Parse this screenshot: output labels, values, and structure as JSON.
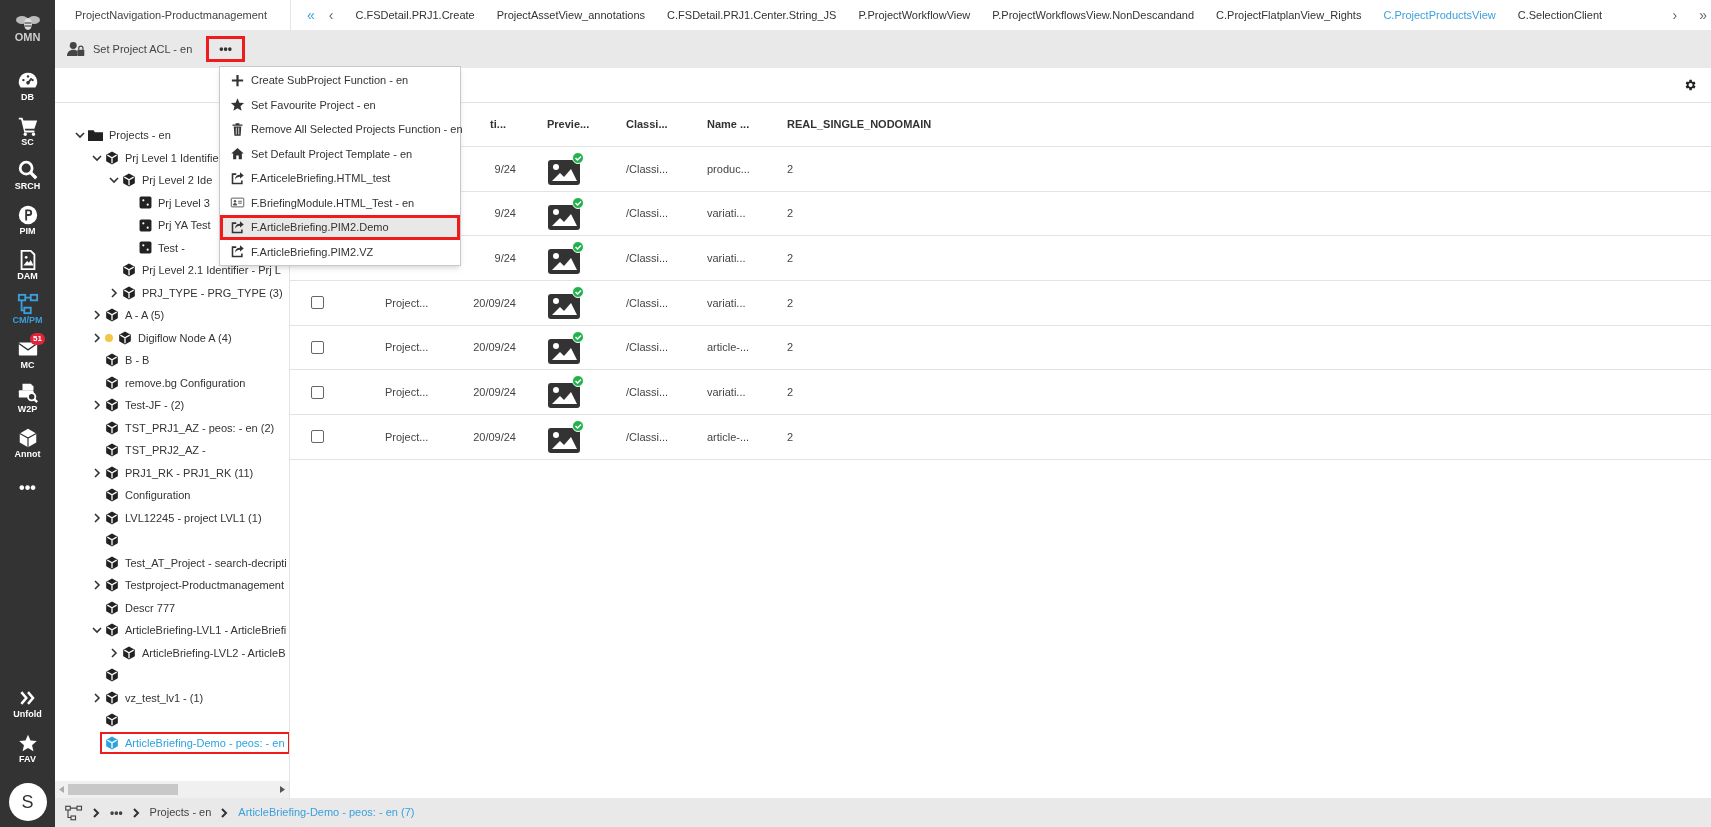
{
  "sidebar": {
    "logo": "OMN",
    "items": [
      {
        "label": "DB",
        "selected": false
      },
      {
        "label": "SC",
        "selected": false
      },
      {
        "label": "SRCH",
        "selected": false
      },
      {
        "label": "PIM",
        "selected": false
      },
      {
        "label": "DAM",
        "selected": false
      },
      {
        "label": "CM/PM",
        "selected": true
      },
      {
        "label": "MC",
        "selected": false,
        "badge": "51"
      },
      {
        "label": "W2P",
        "selected": false
      },
      {
        "label": "Annot",
        "selected": false
      },
      {
        "label": "•••",
        "selected": false
      }
    ],
    "bottom_items": [
      {
        "label": "Unfold"
      },
      {
        "label": "FAV"
      }
    ],
    "avatar": "S"
  },
  "panel_title": "ProjectNavigation-Productmanagement",
  "tab_nav": {
    "first": "«",
    "prev": "‹",
    "next": "›",
    "last": "»"
  },
  "tabs": [
    {
      "label": "C.FSDetail.PRJ1.Create",
      "selected": false
    },
    {
      "label": "ProjectAssetView_annotations",
      "selected": false
    },
    {
      "label": "C.FSDetail.PRJ1.Center.String_JS",
      "selected": false
    },
    {
      "label": "P.ProjectWorkflowView",
      "selected": false
    },
    {
      "label": "P.ProjectWorkflowsView.NonDescandand",
      "selected": false
    },
    {
      "label": "C.ProjectFlatplanView_Rights",
      "selected": false
    },
    {
      "label": "C.ProjectProductsView",
      "selected": true
    },
    {
      "label": "C.SelectionClient",
      "selected": false
    }
  ],
  "toolbar": {
    "acl_button": "Set Project ACL - en",
    "more_button": {
      "label": "•••",
      "highlighted": true
    }
  },
  "menu": [
    {
      "label": "Create SubProject Function - en",
      "selected": false,
      "highlighted": false
    },
    {
      "label": "Set Favourite Project - en",
      "selected": false,
      "highlighted": false
    },
    {
      "label": "Remove All Selected Projects Function - en",
      "selected": false,
      "highlighted": false
    },
    {
      "label": "Set Default Project Template - en",
      "selected": false,
      "highlighted": false
    },
    {
      "label": "F.ArticeleBriefing.HTML_test",
      "selected": false,
      "highlighted": false
    },
    {
      "label": "F.BriefingModule.HTML_Test - en",
      "selected": false,
      "highlighted": false
    },
    {
      "label": "F.ArticleBriefing.PIM2.Demo",
      "selected": true,
      "highlighted": true
    },
    {
      "label": "F.ArticleBriefing.PIM2.VZ",
      "selected": false,
      "highlighted": false
    }
  ],
  "tree": [
    {
      "label": "Projects - en",
      "kind": "folder",
      "expanded": true,
      "children": [
        {
          "label": "Prj Level 1 Identifie",
          "kind": "project",
          "expanded": true,
          "children": [
            {
              "label": "Prj Level 2 Ide",
              "kind": "project",
              "expanded": true,
              "children": [
                {
                  "label": "Prj Level 3",
                  "kind": "template"
                },
                {
                  "label": "Prj YA Test",
                  "kind": "template"
                },
                {
                  "label": "Test -",
                  "kind": "template"
                }
              ]
            },
            {
              "label": "Prj Level 2.1 Identifier - Prj L",
              "kind": "project"
            },
            {
              "label": "PRJ_TYPE - PRG_TYPE (3)",
              "kind": "project",
              "expanded": false
            }
          ]
        },
        {
          "label": "A - A (5)",
          "kind": "project",
          "expanded": false
        },
        {
          "label": "Digiflow Node A (4)",
          "kind": "project",
          "expanded": false,
          "color": "#f2c744"
        },
        {
          "label": "B - B",
          "kind": "project"
        },
        {
          "label": "remove.bg Configuration",
          "kind": "project"
        },
        {
          "label": "Test-JF - (2)",
          "kind": "project",
          "expanded": false
        },
        {
          "label": "TST_PRJ1_AZ - peos: - en (2)",
          "kind": "project"
        },
        {
          "label": "TST_PRJ2_AZ -",
          "kind": "project"
        },
        {
          "label": "PRJ1_RK - PRJ1_RK (11)",
          "kind": "project",
          "expanded": false
        },
        {
          "label": "Configuration",
          "kind": "project"
        },
        {
          "label": "LVL12245 - project LVL1 (1)",
          "kind": "project",
          "expanded": false
        },
        {
          "kind": "project"
        },
        {
          "label": "Test_AT_Project - search-decripti",
          "kind": "project"
        },
        {
          "label": "Testproject-Productmanagement",
          "kind": "project",
          "expanded": false
        },
        {
          "label": "Descr 777",
          "kind": "project"
        },
        {
          "label": "ArticleBriefing-LVL1 - ArticleBriefi",
          "kind": "project",
          "expanded": true,
          "children": [
            {
              "label": "ArticleBriefing-LVL2 - ArticleB",
              "kind": "project",
              "expanded": false
            }
          ]
        },
        {
          "kind": "project"
        },
        {
          "label": "vz_test_lv1 - (1)",
          "kind": "project",
          "expanded": false
        },
        {
          "kind": "project"
        },
        {
          "label": "ArticleBriefing-Demo - peos: - en",
          "kind": "project",
          "selected": true,
          "highlighted": true
        }
      ]
    }
  ],
  "table": {
    "columns": [
      "ti...",
      "Previe...",
      "Classi...",
      "Name ...",
      "REAL_SINGLE_NODOMAIN"
    ],
    "rows": [
      {
        "date": "9/24",
        "preview_ok": true,
        "classification": "/Classi...",
        "name": "produc...",
        "real": "2"
      },
      {
        "date": "9/24",
        "preview_ok": true,
        "classification": "/Classi...",
        "name": "variati...",
        "real": "2"
      },
      {
        "date": "9/24",
        "preview_ok": true,
        "classification": "/Classi...",
        "name": "variati...",
        "real": "2"
      },
      {
        "checked": false,
        "project": "Project...",
        "date": "20/09/24",
        "preview_ok": true,
        "classification": "/Classi...",
        "name": "variati...",
        "real": "2"
      },
      {
        "checked": false,
        "project": "Project...",
        "date": "20/09/24",
        "preview_ok": true,
        "classification": "/Classi...",
        "name": "article-...",
        "real": "2"
      },
      {
        "checked": false,
        "project": "Project...",
        "date": "20/09/24",
        "preview_ok": true,
        "classification": "/Classi...",
        "name": "variati...",
        "real": "2"
      },
      {
        "checked": false,
        "project": "Project...",
        "date": "20/09/24",
        "preview_ok": true,
        "classification": "/Classi...",
        "name": "article-...",
        "real": "2"
      }
    ]
  },
  "breadcrumb": [
    {
      "label": "•••",
      "current": false
    },
    {
      "label": "Projects - en",
      "current": false
    },
    {
      "label": "ArticleBriefing-Demo - peos: - en (7)",
      "current": true
    }
  ]
}
